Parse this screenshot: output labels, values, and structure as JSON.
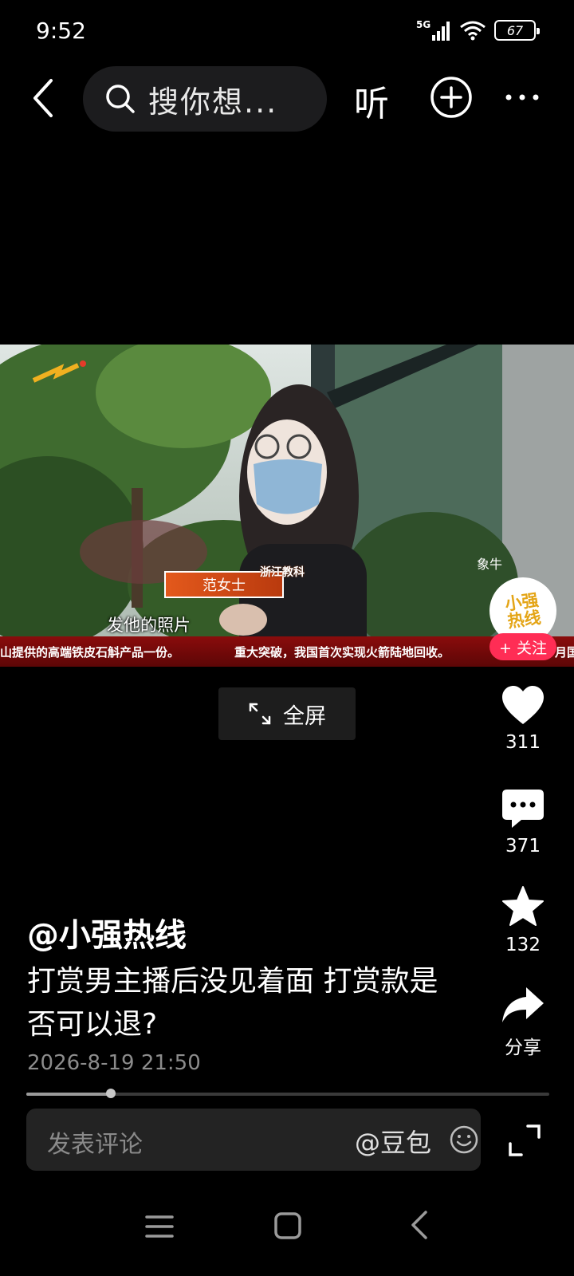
{
  "status_bar": {
    "time": "9:52",
    "network": "5G",
    "battery": "67"
  },
  "top_nav": {
    "search_placeholder": "搜你想...",
    "listen_label": "听"
  },
  "video": {
    "subtitle": "发他的照片",
    "name_tag": "范女士",
    "channel_label": "浙江教科",
    "ticker": [
      "山提供的高端铁皮石斛产品一份。",
      "重大突破，我国首次实现火箭陆地回收。",
      "月国"
    ],
    "avatar_text_line1": "小强",
    "avatar_text_line2": "热线",
    "follow_label": "+ 关注",
    "corner_text": "象牛"
  },
  "fullscreen_label": "全屏",
  "actions": {
    "like_count": "311",
    "comment_count": "371",
    "favorite_count": "132",
    "share_label": "分享"
  },
  "post": {
    "author": "@小强热线",
    "caption": "打赏男主播后没见着面 打赏款是否可以退?",
    "timestamp": "2026-8-19 21:50"
  },
  "progress": {
    "fraction": 0.161
  },
  "comment_bar": {
    "placeholder": "发表评论",
    "mention": "@豆包"
  },
  "colors": {
    "accent_red": "#ff2d55",
    "background": "#000000"
  }
}
